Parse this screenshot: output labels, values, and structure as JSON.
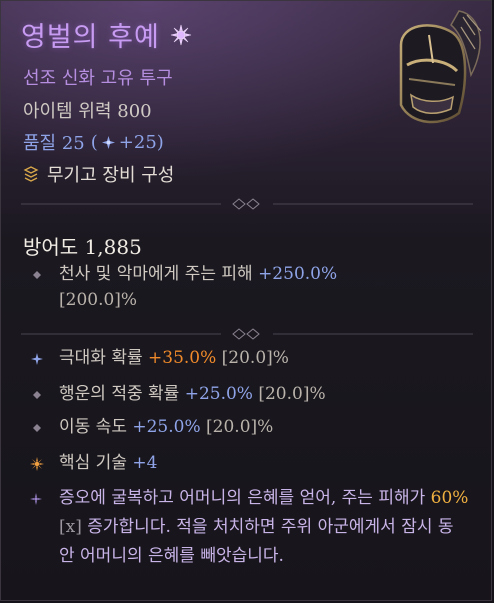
{
  "item": {
    "name": "영벌의 후예",
    "rarity": "선조 신화 고유 투구",
    "power": "아이템 위력 800",
    "quality_label": "품질 25",
    "quality_open": "(",
    "quality_bonus": "+25)",
    "config": "무기고 장비 구성",
    "armor": "방어도 1,885"
  },
  "implicit": {
    "line1_prefix": "천사 및 악마에게 주는 피해 ",
    "line1_value": "+250.0%",
    "line1_range": "[200.0]%"
  },
  "affixes": [
    {
      "prefix": "극대화 확률 ",
      "value": "+35.0%",
      "range": " [20.0]%"
    },
    {
      "prefix": "행운의 적중 확률 ",
      "value": "+25.0%",
      "range": " [20.0]%"
    },
    {
      "prefix": "이동 속도 ",
      "value": "+25.0%",
      "range": " [20.0]%"
    },
    {
      "prefix": "핵심 기술 ",
      "value": "+4",
      "range": ""
    }
  ],
  "legendary": {
    "part1": "증오에 굴복하고 어머니의 은혜를 얻어, 주는 피해가 ",
    "num": "60%",
    "x": "[x]",
    "part2": " 증가합니다. 적을 처치하면 주위 아군에게서 잠시 동안 어머니의 은혜를 빼앗습니다."
  },
  "colors": {
    "name": "#c89bf2",
    "rarity": "#b68ee0",
    "blue_value": "#8fa4e8",
    "orange_value": "#f08a2a",
    "legendary_text": "#c9b4e8",
    "legendary_num": "#f0b040"
  },
  "icons": {
    "title": "mythic-sun-icon",
    "quality": "greater-affix-star-icon",
    "config": "armory-icon",
    "bullet": "diamond-bullet-icon",
    "crit": "blue-star-icon",
    "core": "orange-star-icon",
    "legendary": "purple-star-icon",
    "item": "winged-helm-icon"
  }
}
